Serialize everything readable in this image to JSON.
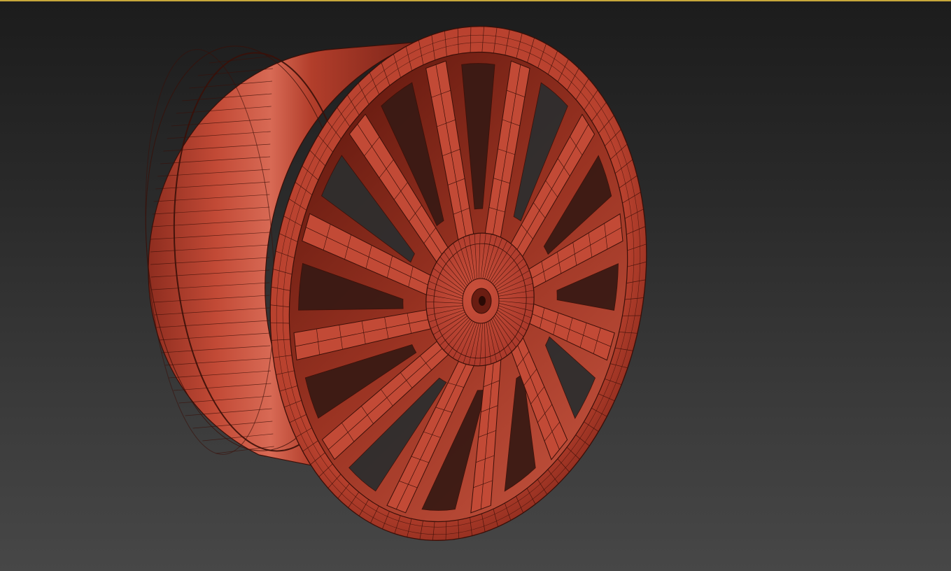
{
  "viewport": {
    "active_border_color": "#c7a83a",
    "background_top": "#1c1c1c",
    "background_bottom": "#474747"
  },
  "model": {
    "object": "wheel-rim",
    "spoke_count": 12,
    "wireframe_shown": true,
    "material_color": "#c24a36",
    "material_shadow_color": "#7a2318",
    "material_highlight_color": "#e07a66",
    "wire_color": "#3a0f08"
  }
}
